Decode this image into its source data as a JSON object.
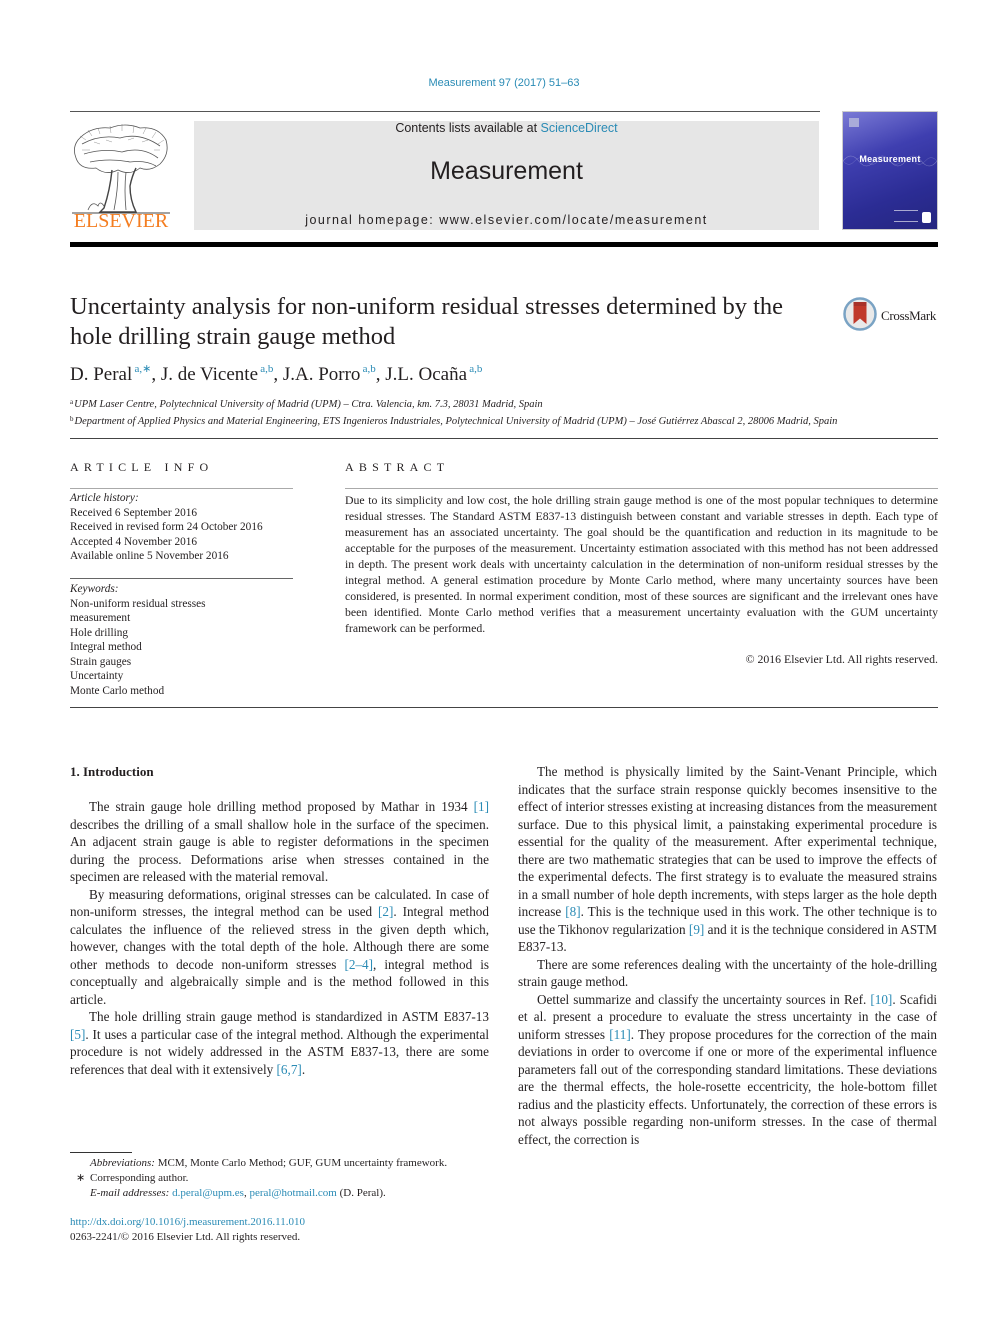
{
  "header": {
    "journal_citation": "Measurement 97 (2017) 51–63",
    "contents_prefix": "Contents lists available at ",
    "contents_link": "ScienceDirect",
    "journal_title": "Measurement",
    "homepage_label": "journal homepage: www.elsevier.com/locate/measurement",
    "publisher_wordmark": "ELSEVIER",
    "cover_title": "Measurement",
    "colors": {
      "link": "#2a8bb5",
      "elsevier_orange": "#f47d20",
      "cover_blue": "#2b2c94",
      "masthead_gray": "#e6e6e6"
    }
  },
  "article": {
    "title": "Uncertainty analysis for non-uniform residual stresses determined by the hole drilling strain gauge method",
    "crossmark_label": "CrossMark",
    "authors": [
      {
        "name": "D. Peral",
        "marks": "a,∗"
      },
      {
        "name": "J. de Vicente",
        "marks": "a,b"
      },
      {
        "name": "J.A. Porro",
        "marks": "a,b"
      },
      {
        "name": "J.L. Ocaña",
        "marks": "a,b"
      }
    ],
    "affiliations": [
      {
        "mark": "a",
        "text": "UPM Laser Centre, Polytechnical University of Madrid (UPM) – Ctra. Valencia, km. 7.3, 28031 Madrid, Spain"
      },
      {
        "mark": "b",
        "text": "Department of Applied Physics and Material Engineering, ETS Ingenieros Industriales, Polytechnical University of Madrid (UPM) – José Gutiérrez Abascal 2, 28006 Madrid, Spain"
      }
    ]
  },
  "article_info": {
    "heading": "ARTICLE INFO",
    "history_label": "Article history:",
    "history": [
      "Received 6 September 2016",
      "Received in revised form 24 October 2016",
      "Accepted 4 November 2016",
      "Available online 5 November 2016"
    ],
    "keywords_label": "Keywords:",
    "keywords": [
      "Non-uniform residual stresses",
      "measurement",
      "Hole drilling",
      "Integral method",
      "Strain gauges",
      "Uncertainty",
      "Monte Carlo method"
    ]
  },
  "abstract": {
    "heading": "ABSTRACT",
    "text": "Due to its simplicity and low cost, the hole drilling strain gauge method is one of the most popular techniques to determine residual stresses. The Standard ASTM E837-13 distinguish between constant and variable stresses in depth. Each type of measurement has an associated uncertainty. The goal should be the quantification and reduction in its magnitude to be acceptable for the purposes of the measurement. Uncertainty estimation associated with this method has not been addressed in depth. The present work deals with uncertainty calculation in the determination of non-uniform residual stresses by the integral method. A general estimation procedure by Monte Carlo method, where many uncertainty sources have been considered, is presented. In normal experiment condition, most of these sources are significant and the irrelevant ones have been identified. Monte Carlo method verifies that a measurement uncertainty evaluation with the GUM uncertainty framework can be performed.",
    "copyright": "© 2016 Elsevier Ltd. All rights reserved."
  },
  "body": {
    "section_heading": "1. Introduction",
    "left_paragraphs": [
      [
        {
          "t": "The strain gauge hole drilling method proposed by Mathar in 1934 "
        },
        {
          "ref": "[1]"
        },
        {
          "t": " describes the drilling of a small shallow hole in the surface of the specimen. An adjacent strain gauge is able to register deformations in the specimen during the process. Deformations arise when stresses contained in the specimen are released with the material removal."
        }
      ],
      [
        {
          "t": "By measuring deformations, original stresses can be calculated. In case of non-uniform stresses, the integral method can be used "
        },
        {
          "ref": "[2]"
        },
        {
          "t": ". Integral method calculates the influence of the relieved stress in the given depth which, however, changes with the total depth of the hole. Although there are some other methods to decode non-uniform stresses "
        },
        {
          "ref": "[2–4]"
        },
        {
          "t": ", integral method is conceptually and algebraically simple and is the method followed in this article."
        }
      ],
      [
        {
          "t": "The hole drilling strain gauge method is standardized in ASTM E837-13 "
        },
        {
          "ref": "[5]"
        },
        {
          "t": ". It uses a particular case of the integral method. Although the experimental procedure is not widely addressed in the ASTM E837-13, there are some references that deal with it extensively "
        },
        {
          "ref": "[6,7]"
        },
        {
          "t": "."
        }
      ]
    ],
    "right_paragraphs": [
      [
        {
          "t": "The method is physically limited by the Saint-Venant Principle, which indicates that the surface strain response quickly becomes insensitive to the effect of interior stresses existing at increasing distances from the measurement surface. Due to this physical limit, a painstaking experimental procedure is essential for the quality of the measurement. After experimental technique, there are two mathematic strategies that can be used to improve the effects of the experimental defects. The first strategy is to evaluate the measured strains in a small number of hole depth increments, with steps larger as the hole depth increase "
        },
        {
          "ref": "[8]"
        },
        {
          "t": ". This is the technique used in this work. The other technique is to use the Tikhonov regularization "
        },
        {
          "ref": "[9]"
        },
        {
          "t": " and it is the technique considered in ASTM E837-13."
        }
      ],
      [
        {
          "t": "There are some references dealing with the uncertainty of the hole-drilling strain gauge method."
        }
      ],
      [
        {
          "t": "Oettel summarize and classify the uncertainty sources in Ref. "
        },
        {
          "ref": "[10]"
        },
        {
          "t": ". Scafidi et al. present a procedure to evaluate the stress uncertainty in the case of uniform stresses "
        },
        {
          "ref": "[11]"
        },
        {
          "t": ". They propose procedures for the correction of the main deviations in order to overcome if one or more of the experimental influence parameters fall out of the corresponding standard limitations. These deviations are the thermal effects, the hole-rosette eccentricity, the hole-bottom fillet radius and the plasticity effects. Unfortunately, the correction of these errors is not always possible regarding non-uniform stresses. In the case of thermal effect, the correction is"
        }
      ]
    ]
  },
  "footnotes": {
    "abbreviations_label": "Abbreviations:",
    "abbreviations_text": " MCM, Monte Carlo Method; GUF, GUM uncertainty framework.",
    "corresponding_mark": "∗",
    "corresponding_text": "Corresponding author.",
    "email_label": "E-mail addresses:",
    "emails": [
      "d.peral@upm.es",
      "peral@hotmail.com"
    ],
    "email_owner": " (D. Peral).",
    "doi": "http://dx.doi.org/10.1016/j.measurement.2016.11.010",
    "issn_copyright": "0263-2241/© 2016 Elsevier Ltd. All rights reserved."
  }
}
